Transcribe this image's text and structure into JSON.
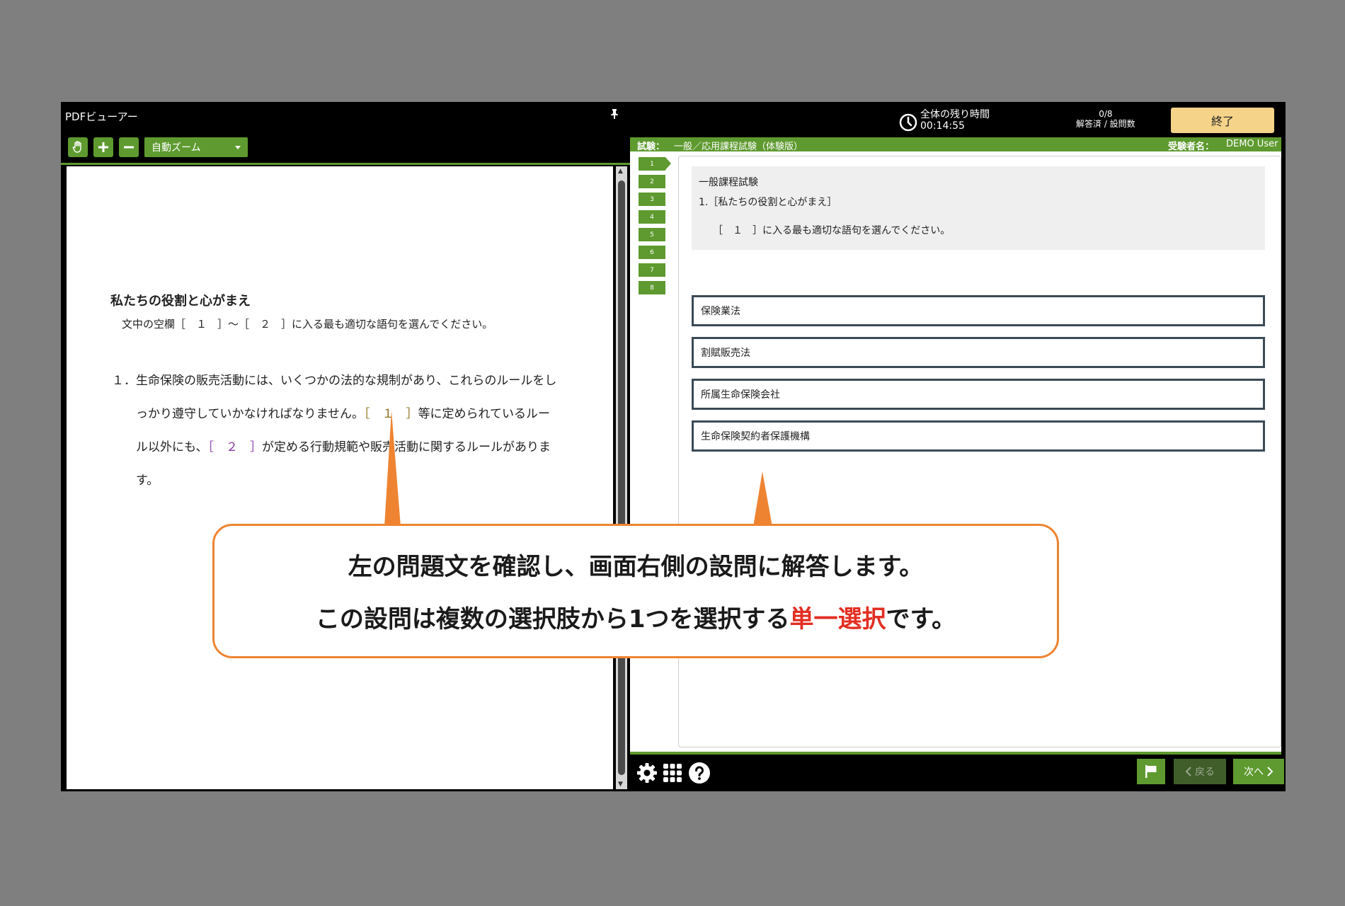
{
  "left_pane": {
    "title": "PDFビューアー",
    "zoom_label": "自動ズーム",
    "document": {
      "heading": "私たちの役割と心がまえ",
      "instruction": "文中の空欄［　１　］～［　２　］に入る最も適切な語句を選んでください。",
      "item_number": "１．",
      "lines": [
        "生命保険の販売活動には、いくつかの法的な規制があり、これらのルールをし",
        "っかり遵守していかなければなりません。",
        "［　１　］",
        "等に定められているルー",
        "ル以外にも、",
        "［　２　］",
        "が定める行動規範や販売活動に関するルールがありま",
        "す。"
      ]
    }
  },
  "header": {
    "time_label": "全体の残り時間",
    "time_value": "00:14:55",
    "answered_count": "0/8",
    "answered_label": "解答済 / 設問数",
    "end_button": "終了"
  },
  "exam_bar": {
    "exam_label": "試験：",
    "exam_name": "一般／応用課程試験（体験版）",
    "user_label": "受験者名：",
    "user_name": "DEMO User"
  },
  "question_nav": [
    "1",
    "2",
    "3",
    "4",
    "5",
    "6",
    "7",
    "8"
  ],
  "question": {
    "section": "一般課程試験",
    "title": "1.［私たちの役割と心がまえ］",
    "text": "［　１　］に入る最も適切な語句を選んでください。"
  },
  "choices": [
    "保険業法",
    "割賦販売法",
    "所属生命保険会社",
    "生命保険契約者保護機構"
  ],
  "footer": {
    "back_label": "戻る",
    "next_label": "次へ"
  },
  "callout": {
    "line1": "左の問題文を確認し、画面右側の設問に解答します。",
    "line2_prefix": "この設問は複数の選択肢から1つを選択する",
    "line2_accent": "単一選択",
    "line2_suffix": "です。"
  },
  "colors": {
    "accent_green": "#5e9a2f",
    "end_button": "#f5d389",
    "callout_border": "#ee8432",
    "callout_accent": "#e32e22"
  }
}
